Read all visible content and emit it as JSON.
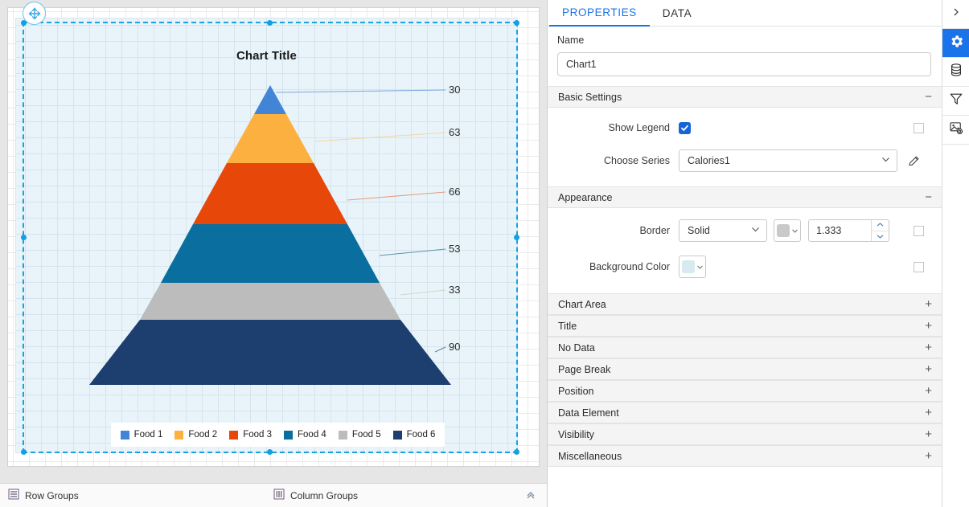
{
  "designer": {
    "move_handle_icon": "move-cross-icon",
    "group_bar": {
      "row_groups_label": "Row Groups",
      "row_groups_icon": "row-groups-icon",
      "column_groups_label": "Column Groups",
      "column_groups_icon": "column-groups-icon",
      "collapse_icon": "chevron-double-up-icon"
    }
  },
  "chart_data": {
    "type": "pie",
    "chart_style": "pyramid",
    "title": "Chart Title",
    "categories": [
      "Food 1",
      "Food 2",
      "Food 3",
      "Food 4",
      "Food 5",
      "Food 6"
    ],
    "values": [
      30,
      63,
      66,
      53,
      33,
      90
    ],
    "colors": [
      "#4285d6",
      "#fcb040",
      "#e8470a",
      "#0a6f9e",
      "#bcbcbc",
      "#1d3f70"
    ],
    "labels": [
      "30",
      "63",
      "66",
      "53",
      "33",
      "90"
    ],
    "legend_position": "bottom",
    "legend_visible": true,
    "grid": true,
    "xlabel": "",
    "ylabel": ""
  },
  "properties": {
    "tabs": [
      {
        "label": "PROPERTIES",
        "active": true
      },
      {
        "label": "DATA",
        "active": false
      }
    ],
    "name_field": {
      "label": "Name",
      "value": "Chart1"
    },
    "basic_settings": {
      "header": "Basic Settings",
      "state_sign": "−",
      "show_legend": {
        "label": "Show Legend",
        "checked": true,
        "expression_checkbox": false
      },
      "choose_series": {
        "label": "Choose Series",
        "value": "Calories1",
        "edit_icon": "pencil-icon"
      }
    },
    "appearance": {
      "header": "Appearance",
      "state_sign": "−",
      "border": {
        "label": "Border",
        "style_value": "Solid",
        "color_value": "#c9c9c9",
        "width_value": "1.333",
        "expression_checkbox": false
      },
      "background_color": {
        "label": "Background Color",
        "color_value": "#d6eaf0",
        "expression_checkbox": false
      }
    },
    "collapsed_sections": [
      {
        "label": "Chart Area",
        "state_sign": "+"
      },
      {
        "label": "Title",
        "state_sign": "+"
      },
      {
        "label": "No Data",
        "state_sign": "+"
      },
      {
        "label": "Page Break",
        "state_sign": "+"
      },
      {
        "label": "Position",
        "state_sign": "+"
      },
      {
        "label": "Data Element",
        "state_sign": "+"
      },
      {
        "label": "Visibility",
        "state_sign": "+"
      },
      {
        "label": "Miscellaneous",
        "state_sign": "+"
      }
    ]
  },
  "rail": {
    "items": [
      {
        "icon": "chevron-right-icon",
        "active": false
      },
      {
        "icon": "gear-icon",
        "active": true
      },
      {
        "icon": "database-icon",
        "active": false
      },
      {
        "icon": "filter-icon",
        "active": false
      },
      {
        "icon": "image-settings-icon",
        "active": false
      }
    ]
  },
  "theme": {
    "accent": "#1a73e8",
    "canvas_bg": "#e8f4fa",
    "selection": "#1aa1e0"
  }
}
